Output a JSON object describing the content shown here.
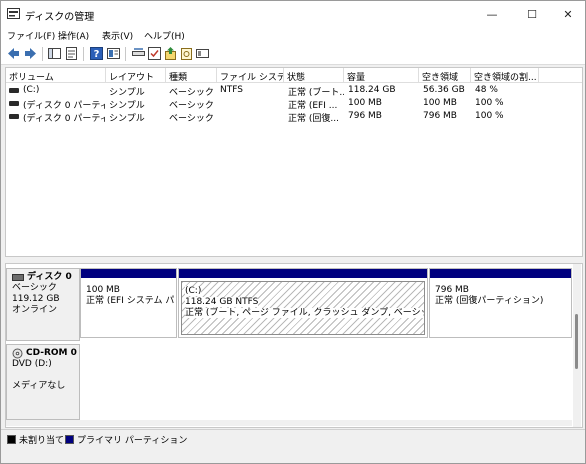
{
  "window": {
    "title": "ディスクの管理",
    "minimize_glyph": "—",
    "maximize_glyph": "☐",
    "close_glyph": "✕"
  },
  "menu": [
    "ファイル(F)",
    "操作(A)",
    "表示(V)",
    "ヘルプ(H)"
  ],
  "toolbar": [
    "back-arrow-icon",
    "forward-arrow-icon",
    "show-hide-console-tree-icon",
    "properties-icon",
    "help-icon",
    "view-icon",
    "connect-disk-icon",
    "check-icon",
    "import-icon",
    "rescan-icon",
    "settings-icon"
  ],
  "volume_table": {
    "columns": [
      "ボリューム",
      "レイアウト",
      "種類",
      "ファイル システム",
      "状態",
      "容量",
      "空き領域",
      "空き領域の割..."
    ],
    "rows": [
      [
        "(C:)",
        "シンプル",
        "ベーシック",
        "NTFS",
        "正常 (ブート...",
        "118.24 GB",
        "56.36 GB",
        "48 %"
      ],
      [
        "(ディスク 0 パーティシ...",
        "シンプル",
        "ベーシック",
        "",
        "正常 (EFI ...",
        "100 MB",
        "100 MB",
        "100 %"
      ],
      [
        "(ディスク 0 パーティシ...",
        "シンプル",
        "ベーシック",
        "",
        "正常 (回復...",
        "796 MB",
        "796 MB",
        "100 %"
      ]
    ]
  },
  "disks": [
    {
      "name": "ディスク 0",
      "type": "ベーシック",
      "size": "119.12 GB",
      "status": "オンライン",
      "partitions": [
        {
          "title": "",
          "size": "100 MB",
          "status": "正常 (EFI システム パーティション)"
        },
        {
          "title": "(C:)",
          "size": "118.24 GB NTFS",
          "status": "正常 (ブート, ページ ファイル, クラッシュ ダンプ, ベーシック データ パーティション)"
        },
        {
          "title": "",
          "size": "796 MB",
          "status": "正常 (回復パーティション)"
        }
      ]
    },
    {
      "name": "CD-ROM 0",
      "type": "DVD (D:)",
      "size": "",
      "status": "メディアなし"
    }
  ],
  "legend": [
    {
      "label": "未割り当て",
      "color": "#000000"
    },
    {
      "label": "プライマリ パーティション",
      "color": "#00007f"
    }
  ],
  "colors": {
    "primary_partition_band": "#00007f",
    "unallocated": "#000000"
  }
}
